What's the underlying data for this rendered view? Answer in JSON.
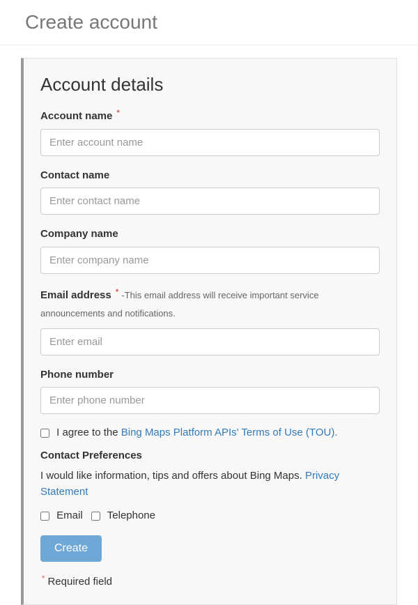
{
  "page": {
    "title": "Create account"
  },
  "form": {
    "heading": "Account details",
    "fields": {
      "account_name": {
        "label": "Account name",
        "placeholder": "Enter account name",
        "required": true
      },
      "contact_name": {
        "label": "Contact name",
        "placeholder": "Enter contact name",
        "required": false
      },
      "company_name": {
        "label": "Company name",
        "placeholder": "Enter company name",
        "required": false
      },
      "email": {
        "label": "Email address",
        "hint": "-This email address will receive important service announcements and notifications.",
        "placeholder": "Enter email",
        "required": true
      },
      "phone": {
        "label": "Phone number",
        "placeholder": "Enter phone number",
        "required": false
      }
    },
    "agree": {
      "prefix": "I agree to the ",
      "link_text": "Bing Maps Platform APIs' Terms of Use (TOU)."
    },
    "preferences": {
      "heading": "Contact Preferences",
      "intro_prefix": "I would like information, tips and offers about Bing Maps. ",
      "privacy_link": "Privacy Statement",
      "email_label": "Email",
      "telephone_label": "Telephone"
    },
    "submit_label": "Create",
    "required_note": "Required field",
    "asterisk": "*"
  }
}
